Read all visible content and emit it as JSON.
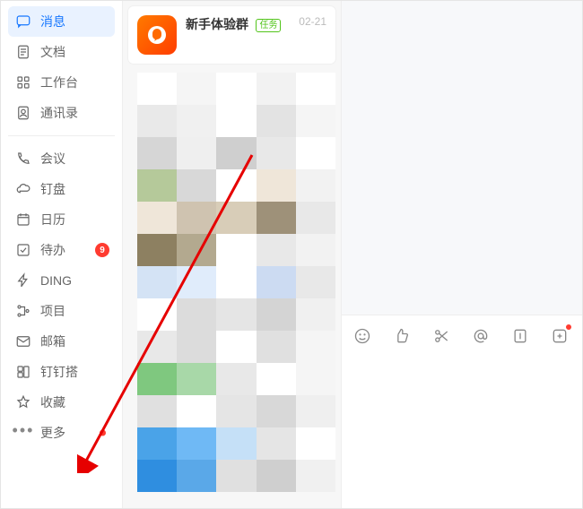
{
  "sidebar": {
    "items": [
      {
        "label": "消息",
        "name": "sidebar-item-messages",
        "active": true
      },
      {
        "label": "文档",
        "name": "sidebar-item-docs"
      },
      {
        "label": "工作台",
        "name": "sidebar-item-workbench"
      },
      {
        "label": "通讯录",
        "name": "sidebar-item-contacts"
      }
    ],
    "items2": [
      {
        "label": "会议",
        "name": "sidebar-item-meeting"
      },
      {
        "label": "钉盘",
        "name": "sidebar-item-drive"
      },
      {
        "label": "日历",
        "name": "sidebar-item-calendar"
      },
      {
        "label": "待办",
        "name": "sidebar-item-todo",
        "badge": "9"
      },
      {
        "label": "DING",
        "name": "sidebar-item-ding"
      },
      {
        "label": "项目",
        "name": "sidebar-item-project"
      },
      {
        "label": "邮箱",
        "name": "sidebar-item-mail"
      },
      {
        "label": "钉钉搭",
        "name": "sidebar-item-builder"
      },
      {
        "label": "收藏",
        "name": "sidebar-item-favorites"
      },
      {
        "label": "更多",
        "name": "sidebar-item-more",
        "dot": true
      }
    ]
  },
  "conversation": {
    "title": "新手体验群",
    "tag": "任务",
    "time": "02-21"
  },
  "mosaic_colors": [
    "#ffffff",
    "#f5f5f5",
    "#ffffff",
    "#f2f2f2",
    "#ffffff",
    "#e9e9e9",
    "#f0f0f0",
    "#ffffff",
    "#e3e3e3",
    "#f5f5f5",
    "#d6d6d6",
    "#efefef",
    "#cfcfcf",
    "#e8e8e8",
    "#ffffff",
    "#b5c99a",
    "#d8d8d8",
    "#ffffff",
    "#efe6d9",
    "#f2f2f2",
    "#efe6d9",
    "#cfc3b0",
    "#d8cdb8",
    "#9e9179",
    "#e8e8e8",
    "#8d8061",
    "#b3a98f",
    "#ffffff",
    "#e8e8e8",
    "#f2f2f2",
    "#d4e3f5",
    "#e0ecfb",
    "#ffffff",
    "#ccdbf2",
    "#e8e8e8",
    "#ffffff",
    "#dcdcdc",
    "#e5e5e5",
    "#d4d4d4",
    "#f0f0f0",
    "#e8e8e8",
    "#dcdcdc",
    "#ffffff",
    "#e0e0e0",
    "#f5f5f5",
    "#7fc87f",
    "#a8d8a8",
    "#e8e8e8",
    "#ffffff",
    "#f5f5f5",
    "#e0e0e0",
    "#ffffff",
    "#e5e5e5",
    "#d8d8d8",
    "#efefef",
    "#4aa3e8",
    "#6fb9f5",
    "#c5e0f7",
    "#e5e5e5",
    "#ffffff",
    "#2f8ee0",
    "#5aa8e8",
    "#e0e0e0",
    "#cfcfcf",
    "#f0f0f0"
  ]
}
